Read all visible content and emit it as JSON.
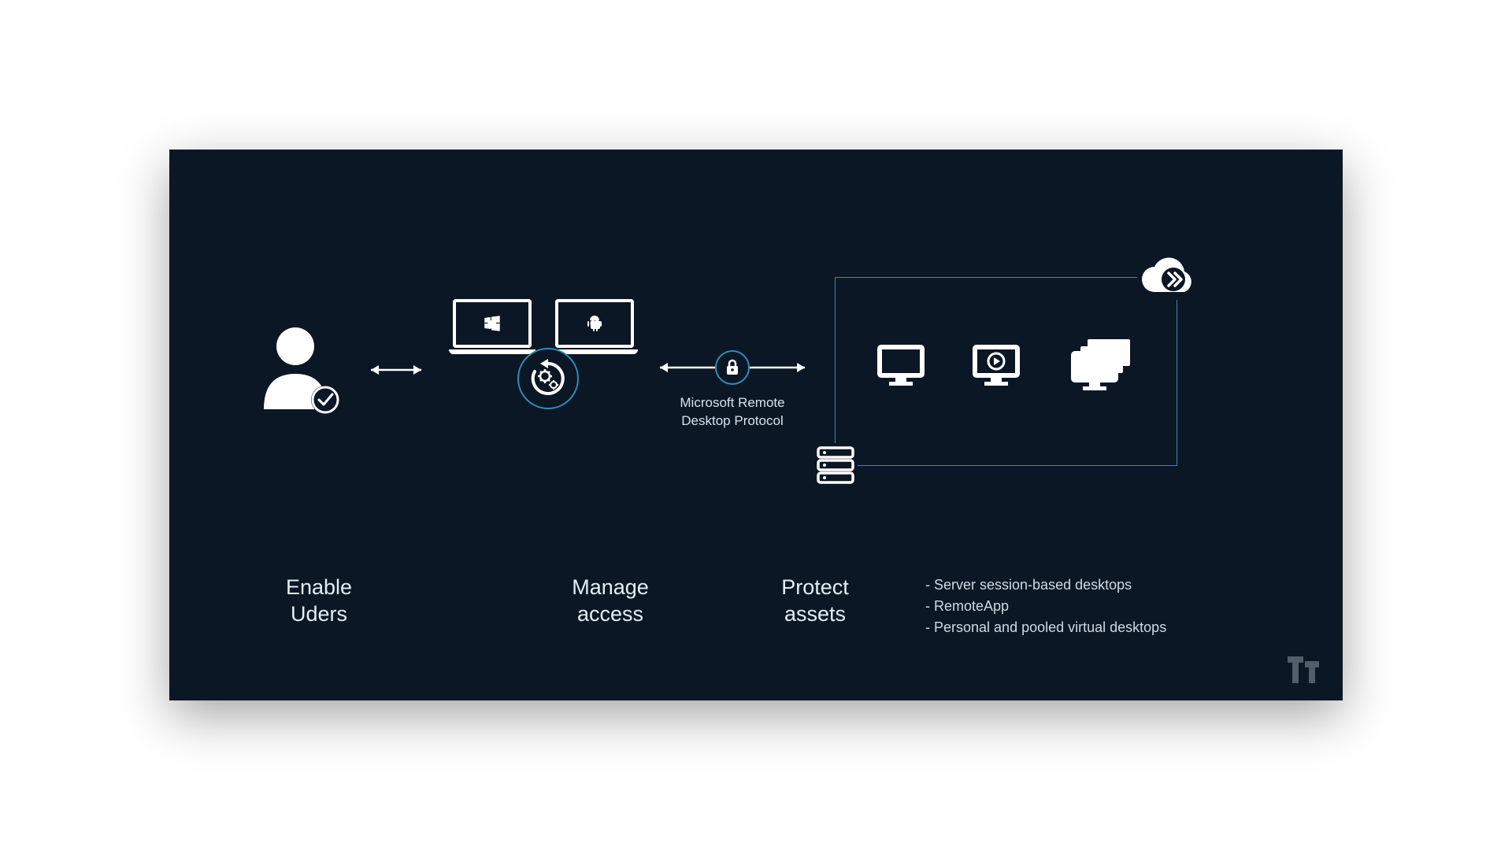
{
  "protocol_label": "Microsoft Remote\nDesktop Protocol",
  "captions": {
    "enable": "Enable\nUders",
    "manage": "Manage\naccess",
    "protect": "Protect\nassets"
  },
  "bullets": [
    "Server session-based desktops",
    "RemoteApp",
    "Personal and pooled virtual desktops"
  ],
  "icons": {
    "user": "user-check-icon",
    "sync": "sync-gears-icon",
    "lock": "lock-icon",
    "windows": "windows-icon",
    "android": "android-icon",
    "apple": "apple-icon",
    "monitor": "monitor-icon",
    "play": "monitor-play-icon",
    "stack": "monitor-stack-icon",
    "server": "server-icon",
    "cloud": "cloud-remote-icon"
  },
  "colors": {
    "bg": "#0c1726",
    "accent": "#2d8eb8",
    "fg": "#ffffff"
  }
}
